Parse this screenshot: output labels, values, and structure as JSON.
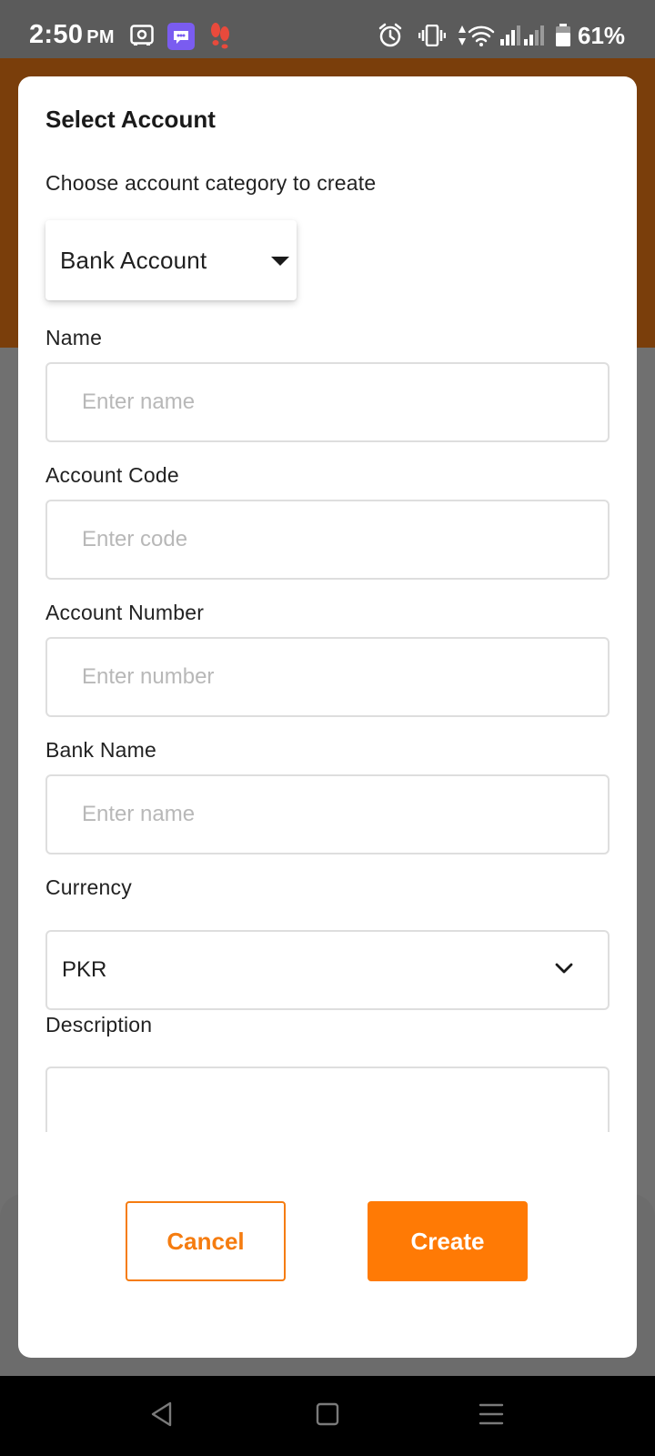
{
  "status_bar": {
    "time": "2:50",
    "ampm": "PM",
    "battery": "61%",
    "icons": [
      "storage-icon",
      "chat-app-icon",
      "footsteps-icon",
      "alarm-icon",
      "vibrate-icon",
      "data-arrows-icon",
      "wifi-icon",
      "signal-icon",
      "signal-icon",
      "battery-icon"
    ]
  },
  "dialog": {
    "title": "Select Account",
    "subtitle": "Choose account category to create",
    "category": {
      "selected": "Bank Account"
    },
    "fields": {
      "name": {
        "label": "Name",
        "placeholder": "Enter name"
      },
      "code": {
        "label": "Account Code",
        "placeholder": "Enter code"
      },
      "number": {
        "label": "Account Number",
        "placeholder": "Enter number"
      },
      "bank": {
        "label": "Bank Name",
        "placeholder": "Enter name"
      },
      "currency": {
        "label": "Currency",
        "value": "PKR"
      },
      "description": {
        "label": "Description",
        "placeholder": ""
      }
    },
    "buttons": {
      "cancel": "Cancel",
      "create": "Create"
    }
  },
  "colors": {
    "accent": "#ff7a05",
    "header_background": "#7a3e0b",
    "overlay": "#707070"
  },
  "nav_bar": {
    "buttons": [
      "back-icon",
      "home-icon",
      "menu-icon"
    ]
  }
}
